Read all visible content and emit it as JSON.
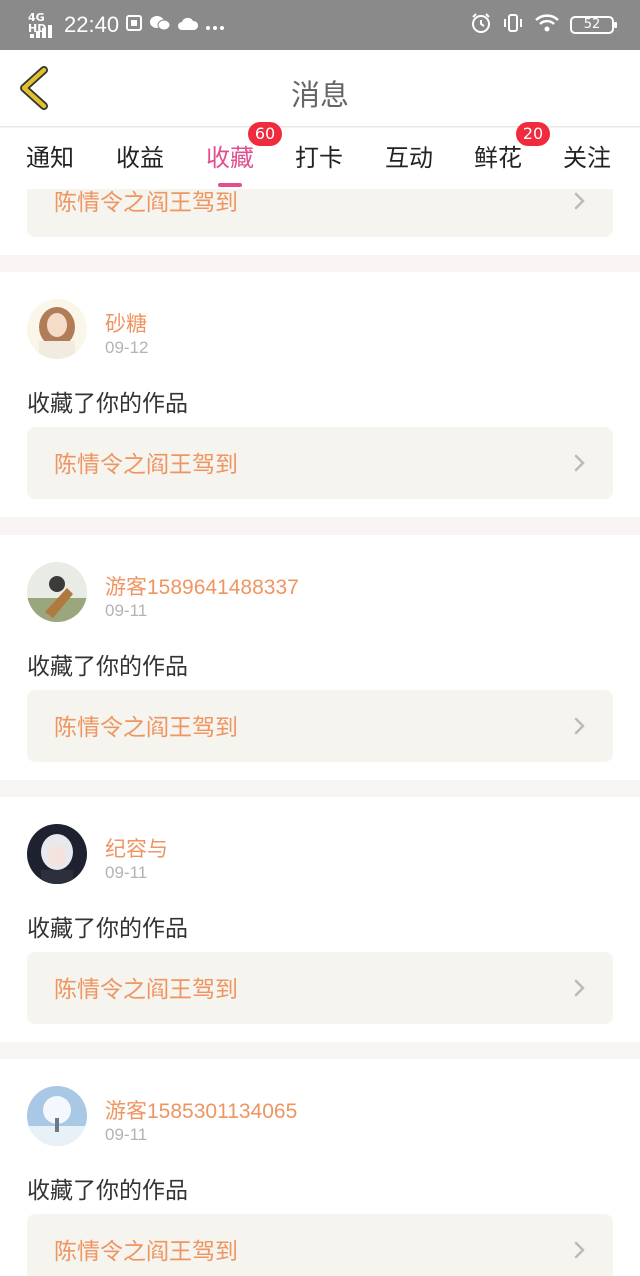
{
  "status_bar": {
    "network": "4G HD",
    "time": "22:40",
    "notification_icons": [
      "sim-icon",
      "wechat-icon",
      "cloud-icon",
      "more-dots-icon"
    ],
    "right_icons": [
      "alarm-icon",
      "vibrate-icon",
      "wifi-icon"
    ],
    "battery": "52"
  },
  "header": {
    "title": "消息",
    "back_icon": "back-chevron-icon",
    "accent_color": "#e2bf2c"
  },
  "tabs": [
    {
      "label": "通知"
    },
    {
      "label": "收益"
    },
    {
      "label": "收藏",
      "badge": "60",
      "active": true
    },
    {
      "label": "打卡"
    },
    {
      "label": "互动"
    },
    {
      "label": "鲜花",
      "badge": "20"
    },
    {
      "label": "关注"
    }
  ],
  "colors": {
    "active_tab": "#e24f8d",
    "badge": "#ef2b3d",
    "username": "#ef9562",
    "work_title": "#ef9562"
  },
  "partial_top_item": {
    "work_title": "陈情令之阎王驾到"
  },
  "notifications": [
    {
      "user": "砂糖",
      "date": "09-12",
      "action": "收藏了你的作品",
      "work_title": "陈情令之阎王驾到",
      "avatar": "avatar-girl"
    },
    {
      "user": "游客1589641488337",
      "date": "09-11",
      "action": "收藏了你的作品",
      "work_title": "陈情令之阎王驾到",
      "avatar": "avatar-guqin"
    },
    {
      "user": "纪容与",
      "date": "09-11",
      "action": "收藏了你的作品",
      "work_title": "陈情令之阎王驾到",
      "avatar": "avatar-anime"
    },
    {
      "user": "游客1585301134065",
      "date": "09-11",
      "action": "收藏了你的作品",
      "work_title": "陈情令之阎王驾到",
      "avatar": "avatar-snow-tree"
    }
  ]
}
